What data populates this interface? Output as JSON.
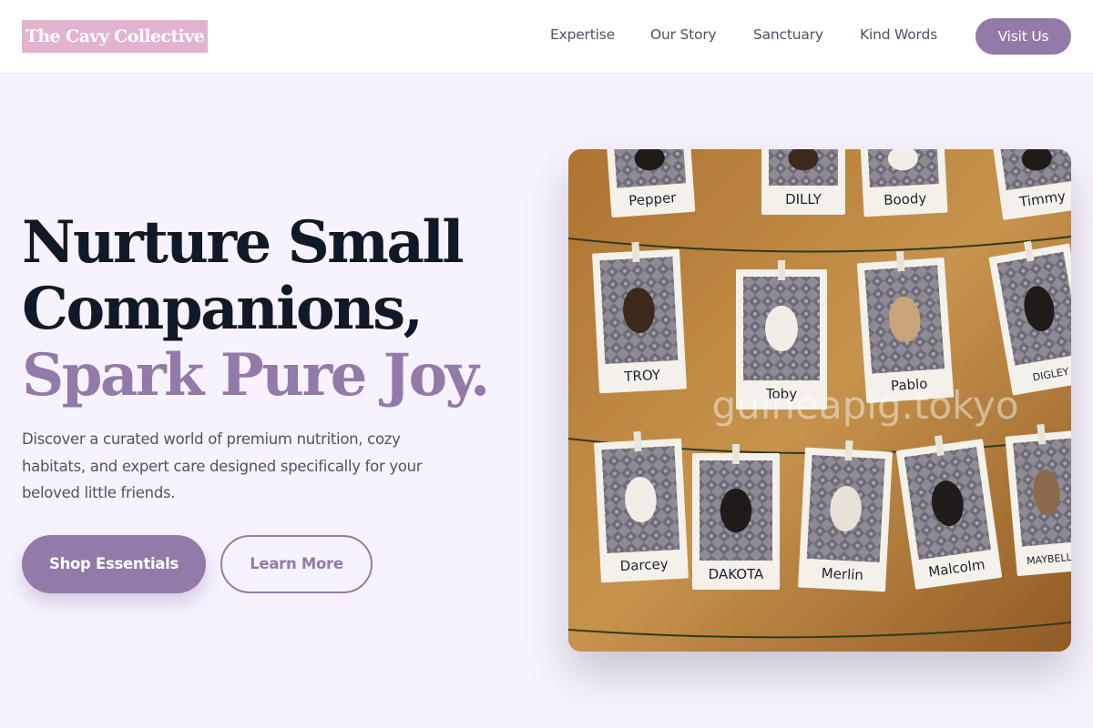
{
  "header": {
    "logo": "The Cavy Collective",
    "nav": [
      "Expertise",
      "Our Story",
      "Sanctuary",
      "Kind Words"
    ],
    "cta": "Visit Us"
  },
  "hero": {
    "headline_line1": "Nurture Small",
    "headline_line2": "Companions,",
    "headline_accent": "Spark Pure Joy.",
    "subtext": "Discover a curated world of premium nutrition, cozy habitats, and expert care designed specifically for your beloved little friends.",
    "primary_button": "Shop Essentials",
    "secondary_button": "Learn More"
  },
  "photo": {
    "watermark": "guineapig.tokyo",
    "names": [
      "Pepper",
      "DILLY",
      "Boody",
      "Timmy",
      "TROY",
      "Toby",
      "Pablo",
      "DIGLEY",
      "Darcey",
      "DAKOTA",
      "Merlin",
      "Malcolm",
      "MAYBELLE"
    ]
  },
  "colors": {
    "accent": "#927ba8",
    "logo_bg": "#e2b3cf",
    "page_bg": "#f7f3fe",
    "heading": "#111827",
    "body_text": "#4b5563"
  }
}
